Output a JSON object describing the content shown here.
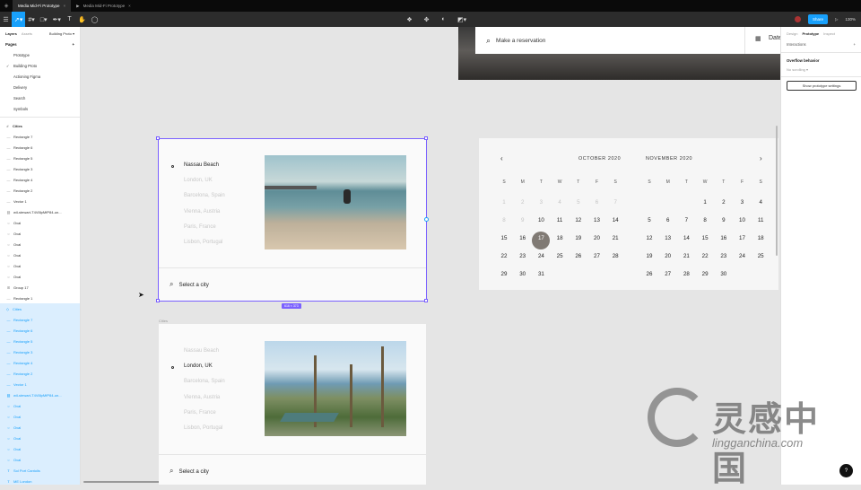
{
  "tabs": [
    {
      "label": "Media Mid-Fi Prototype"
    },
    {
      "label": "Media Mid-Fi Prototype"
    }
  ],
  "toolbar": {
    "share_label": "Share",
    "zoom": "130%"
  },
  "left_panel": {
    "tab_layers": "Layers",
    "tab_assets": "Assets",
    "page_selector": "Building Proto",
    "pages_heading": "Pages",
    "pages": [
      "Prototype",
      "Building Proto",
      "Actioning Figma",
      "Delivery",
      "Search",
      "Symbols"
    ],
    "layers_group1": "Cities",
    "layers1": [
      {
        "icon": "line",
        "label": "Rectangle 7"
      },
      {
        "icon": "line",
        "label": "Rectangle 6"
      },
      {
        "icon": "line",
        "label": "Rectangle 5"
      },
      {
        "icon": "line",
        "label": "Rectangle 3"
      },
      {
        "icon": "line",
        "label": "Rectangle 4"
      },
      {
        "icon": "line",
        "label": "Rectangle 2"
      },
      {
        "icon": "line",
        "label": "Vector 1"
      },
      {
        "icon": "image",
        "label": "wil-stewart-T4Vl8pMfP84-un..."
      },
      {
        "icon": "oval",
        "label": "Oval"
      },
      {
        "icon": "oval",
        "label": "Oval"
      },
      {
        "icon": "oval",
        "label": "Oval"
      },
      {
        "icon": "oval",
        "label": "Oval"
      },
      {
        "icon": "oval",
        "label": "Oval"
      },
      {
        "icon": "oval",
        "label": "Oval"
      },
      {
        "icon": "grid",
        "label": "Group 17"
      },
      {
        "icon": "line",
        "label": "Rectangle 1"
      }
    ],
    "layers_group2": "Cities",
    "layers2": [
      {
        "icon": "line",
        "label": "Rectangle 7"
      },
      {
        "icon": "line",
        "label": "Rectangle 6"
      },
      {
        "icon": "line",
        "label": "Rectangle 5"
      },
      {
        "icon": "line",
        "label": "Rectangle 3"
      },
      {
        "icon": "line",
        "label": "Rectangle 4"
      },
      {
        "icon": "line",
        "label": "Rectangle 2"
      },
      {
        "icon": "line",
        "label": "Vector 1"
      },
      {
        "icon": "image",
        "label": "wil-stewart-T4Vl8pMfP84-un..."
      },
      {
        "icon": "oval",
        "label": "Oval"
      },
      {
        "icon": "oval",
        "label": "Oval"
      },
      {
        "icon": "oval",
        "label": "Oval"
      },
      {
        "icon": "oval",
        "label": "Oval"
      },
      {
        "icon": "oval",
        "label": "Oval"
      },
      {
        "icon": "oval",
        "label": "Oval"
      },
      {
        "icon": "text",
        "label": "Sol Port Cantolis"
      },
      {
        "icon": "text",
        "label": "ME London"
      }
    ]
  },
  "right_panel": {
    "tab_design": "Design",
    "tab_prototype": "Prototype",
    "tab_inspect": "Inspect",
    "interactions": "Interactions",
    "overflow_heading": "Overflow behavior",
    "overflow_value": "No scrolling",
    "settings_button": "Show prototype settings"
  },
  "reservation": {
    "label": "Make a reservation",
    "date_label": "Date"
  },
  "frame1": {
    "cities": [
      "Nassau Beach",
      "London, UK",
      "Barcelona, Spain",
      "Vienna, Austria",
      "Paris, France",
      "Lisbon, Portugal"
    ],
    "selected_index": 0,
    "search_label": "Select a city",
    "size_badge": "616 × 373"
  },
  "frame2": {
    "frame_label": "Cities",
    "cities": [
      "Nassau Beach",
      "London, UK",
      "Barcelona, Spain",
      "Vienna, Austria",
      "Paris, France",
      "Lisbon, Portugal"
    ],
    "selected_index": 1,
    "search_label": "Select a city"
  },
  "calendar": {
    "weekday_headers": [
      "S",
      "M",
      "T",
      "W",
      "T",
      "F",
      "S"
    ],
    "months": [
      {
        "title": "OCTOBER 2020",
        "rows": [
          [
            "1",
            "2",
            "3",
            "4",
            "5",
            "6",
            "7"
          ],
          [
            "8",
            "9",
            "10",
            "11",
            "12",
            "13",
            "14"
          ],
          [
            "15",
            "16",
            "17",
            "18",
            "19",
            "20",
            "21"
          ],
          [
            "22",
            "23",
            "24",
            "25",
            "26",
            "27",
            "28"
          ],
          [
            "29",
            "30",
            "31",
            "",
            "",
            "",
            ""
          ]
        ],
        "disabled_through": "9",
        "selected": "17"
      },
      {
        "title": "NOVEMBER 2020",
        "rows": [
          [
            "",
            "",
            "",
            "1",
            "2",
            "3",
            "4"
          ],
          [
            "5",
            "6",
            "7",
            "8",
            "9",
            "10",
            "11"
          ],
          [
            "12",
            "13",
            "14",
            "15",
            "16",
            "17",
            "18"
          ],
          [
            "19",
            "20",
            "21",
            "22",
            "23",
            "24",
            "25"
          ],
          [
            "26",
            "27",
            "28",
            "29",
            "30",
            "",
            ""
          ]
        ]
      }
    ]
  },
  "watermark": {
    "cn": "灵感中国",
    "en": "lingganchina.com"
  },
  "help": "?",
  "colors": {
    "accent": "#18a0fb",
    "selection": "#7b61ff",
    "selected_day": "#807a74"
  }
}
